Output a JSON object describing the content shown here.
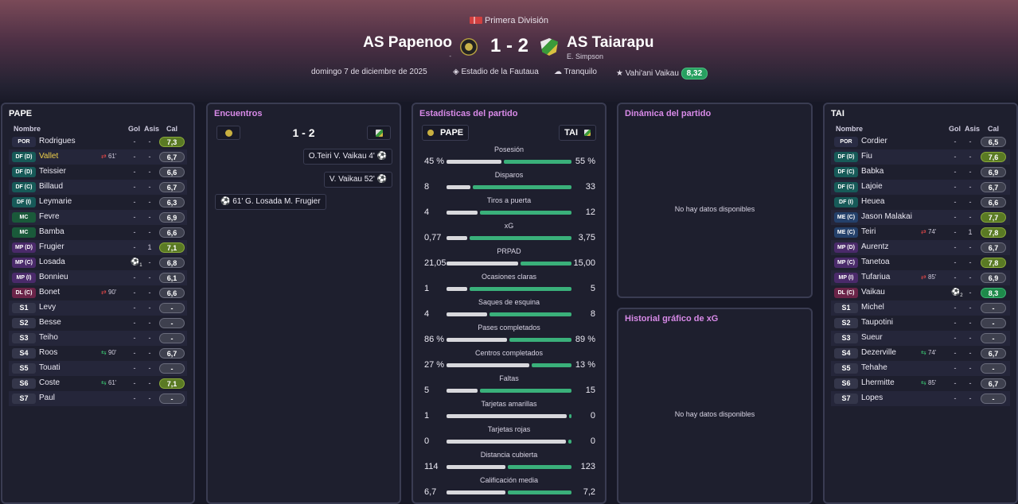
{
  "header": {
    "competition": "Primera División",
    "home_team": "AS Papenoo",
    "home_sub": "-",
    "away_team": "AS Taiarapu",
    "away_sub": "E. Simpson",
    "score": "1 - 2",
    "date": "domingo 7 de diciembre de 2025",
    "stadium": "Estadio de la Fautaua",
    "weather": "Tranquilo",
    "mvp": "Vahi'ani Vaikau",
    "mvp_rating": "8,32"
  },
  "home_lineup": {
    "title": "PAPE",
    "col_name": "Nombre",
    "col_gol": "Gol",
    "col_asis": "Asis",
    "col_cal": "Cal",
    "players": [
      {
        "pos": "POR",
        "cls": "por",
        "name": "Rodrigues",
        "sub": "",
        "gol": "-",
        "asis": "-",
        "cal": "7,3",
        "tier": "g1"
      },
      {
        "pos": "DF (D)",
        "cls": "df",
        "name": "Vallet",
        "sub": "61'",
        "subdir": "out",
        "gol": "-",
        "asis": "-",
        "cal": "6,7",
        "tier": "",
        "hl": true
      },
      {
        "pos": "DF (D)",
        "cls": "df",
        "name": "Teissier",
        "sub": "",
        "gol": "-",
        "asis": "-",
        "cal": "6,6",
        "tier": ""
      },
      {
        "pos": "DF (C)",
        "cls": "df",
        "name": "Billaud",
        "sub": "",
        "gol": "-",
        "asis": "-",
        "cal": "6,7",
        "tier": ""
      },
      {
        "pos": "DF (I)",
        "cls": "df",
        "name": "Leymarie",
        "sub": "",
        "gol": "-",
        "asis": "-",
        "cal": "6,3",
        "tier": ""
      },
      {
        "pos": "MC",
        "cls": "mc",
        "name": "Fevre",
        "sub": "",
        "gol": "-",
        "asis": "-",
        "cal": "6,9",
        "tier": ""
      },
      {
        "pos": "MC",
        "cls": "mc",
        "name": "Bamba",
        "sub": "",
        "gol": "-",
        "asis": "-",
        "cal": "6,6",
        "tier": ""
      },
      {
        "pos": "MP (D)",
        "cls": "mp",
        "name": "Frugier",
        "sub": "",
        "gol": "-",
        "asis": "1",
        "cal": "7,1",
        "tier": "g1"
      },
      {
        "pos": "MP (C)",
        "cls": "mp",
        "name": "Losada",
        "sub": "",
        "ball": "1",
        "gol": "",
        "asis": "-",
        "cal": "6,8",
        "tier": ""
      },
      {
        "pos": "MP (I)",
        "cls": "mp",
        "name": "Bonnieu",
        "sub": "",
        "gol": "-",
        "asis": "-",
        "cal": "6,1",
        "tier": ""
      },
      {
        "pos": "DL (C)",
        "cls": "dl",
        "name": "Bonet",
        "sub": "90'",
        "subdir": "out",
        "gol": "-",
        "asis": "-",
        "cal": "6,6",
        "tier": ""
      },
      {
        "pos": "S1",
        "cls": "sub",
        "name": "Levy",
        "sub": "",
        "gol": "-",
        "asis": "-",
        "cal": "-",
        "tier": ""
      },
      {
        "pos": "S2",
        "cls": "sub",
        "name": "Besse",
        "sub": "",
        "gol": "-",
        "asis": "-",
        "cal": "-",
        "tier": ""
      },
      {
        "pos": "S3",
        "cls": "sub",
        "name": "Teiho",
        "sub": "",
        "gol": "-",
        "asis": "-",
        "cal": "-",
        "tier": ""
      },
      {
        "pos": "S4",
        "cls": "sub",
        "name": "Roos",
        "sub": "90'",
        "subdir": "in",
        "gol": "-",
        "asis": "-",
        "cal": "6,7",
        "tier": ""
      },
      {
        "pos": "S5",
        "cls": "sub",
        "name": "Touati",
        "sub": "",
        "gol": "-",
        "asis": "-",
        "cal": "-",
        "tier": ""
      },
      {
        "pos": "S6",
        "cls": "sub",
        "name": "Coste",
        "sub": "61'",
        "subdir": "in",
        "gol": "-",
        "asis": "-",
        "cal": "7,1",
        "tier": "g1"
      },
      {
        "pos": "S7",
        "cls": "sub",
        "name": "Paul",
        "sub": "",
        "gol": "-",
        "asis": "-",
        "cal": "-",
        "tier": ""
      }
    ]
  },
  "away_lineup": {
    "title": "TAI",
    "col_name": "Nombre",
    "col_gol": "Gol",
    "col_asis": "Asis",
    "col_cal": "Cal",
    "players": [
      {
        "pos": "POR",
        "cls": "por",
        "name": "Cordier",
        "sub": "",
        "gol": "-",
        "asis": "-",
        "cal": "6,5",
        "tier": ""
      },
      {
        "pos": "DF (D)",
        "cls": "df",
        "name": "Fiu",
        "sub": "",
        "gol": "-",
        "asis": "-",
        "cal": "7,6",
        "tier": "g1"
      },
      {
        "pos": "DF (C)",
        "cls": "df",
        "name": "Babka",
        "sub": "",
        "gol": "-",
        "asis": "-",
        "cal": "6,9",
        "tier": ""
      },
      {
        "pos": "DF (C)",
        "cls": "df",
        "name": "Lajoie",
        "sub": "",
        "gol": "-",
        "asis": "-",
        "cal": "6,7",
        "tier": ""
      },
      {
        "pos": "DF (I)",
        "cls": "df",
        "name": "Heuea",
        "sub": "",
        "gol": "-",
        "asis": "-",
        "cal": "6,6",
        "tier": ""
      },
      {
        "pos": "ME (C)",
        "cls": "me",
        "name": "Jason Malakai",
        "sub": "",
        "gol": "-",
        "asis": "-",
        "cal": "7,7",
        "tier": "g1"
      },
      {
        "pos": "ME (C)",
        "cls": "me",
        "name": "Teiri",
        "sub": "74'",
        "subdir": "out",
        "gol": "-",
        "asis": "1",
        "cal": "7,8",
        "tier": "g1"
      },
      {
        "pos": "MP (D)",
        "cls": "mp",
        "name": "Aurentz",
        "sub": "",
        "gol": "-",
        "asis": "-",
        "cal": "6,7",
        "tier": ""
      },
      {
        "pos": "MP (C)",
        "cls": "mp",
        "name": "Tanetoa",
        "sub": "",
        "gol": "-",
        "asis": "-",
        "cal": "7,8",
        "tier": "g1"
      },
      {
        "pos": "MP (I)",
        "cls": "mp",
        "name": "Tufariua",
        "sub": "85'",
        "subdir": "out",
        "gol": "-",
        "asis": "-",
        "cal": "6,9",
        "tier": ""
      },
      {
        "pos": "DL (C)",
        "cls": "dl",
        "name": "Vaikau",
        "sub": "",
        "ball": "2",
        "gol": "",
        "asis": "-",
        "cal": "8,3",
        "tier": "g2"
      },
      {
        "pos": "S1",
        "cls": "sub",
        "name": "Michel",
        "sub": "",
        "gol": "-",
        "asis": "-",
        "cal": "-",
        "tier": ""
      },
      {
        "pos": "S2",
        "cls": "sub",
        "name": "Taupotini",
        "sub": "",
        "gol": "-",
        "asis": "-",
        "cal": "-",
        "tier": ""
      },
      {
        "pos": "S3",
        "cls": "sub",
        "name": "Sueur",
        "sub": "",
        "gol": "-",
        "asis": "-",
        "cal": "-",
        "tier": ""
      },
      {
        "pos": "S4",
        "cls": "sub",
        "name": "Dezerville",
        "sub": "74'",
        "subdir": "in",
        "gol": "-",
        "asis": "-",
        "cal": "6,7",
        "tier": ""
      },
      {
        "pos": "S5",
        "cls": "sub",
        "name": "Tehahe",
        "sub": "",
        "gol": "-",
        "asis": "-",
        "cal": "-",
        "tier": ""
      },
      {
        "pos": "S6",
        "cls": "sub",
        "name": "Lhermitte",
        "sub": "85'",
        "subdir": "in",
        "gol": "-",
        "asis": "-",
        "cal": "6,7",
        "tier": ""
      },
      {
        "pos": "S7",
        "cls": "sub",
        "name": "Lopes",
        "sub": "",
        "gol": "-",
        "asis": "-",
        "cal": "-",
        "tier": ""
      }
    ]
  },
  "encounters": {
    "title": "Encuentros",
    "score": "1 - 2",
    "events": [
      {
        "text": "O.Teiri  V. Vaikau  4'",
        "side": "away"
      },
      {
        "text": "V. Vaikau  52'",
        "side": "away"
      },
      {
        "text": "61'  G. Losada  M. Frugier",
        "side": "home"
      }
    ]
  },
  "stats": {
    "title": "Estadísticas del partido",
    "home_tag": "PAPE",
    "away_tag": "TAI",
    "rows": [
      {
        "label": "Posesión",
        "home": "45 %",
        "away": "55 %",
        "hv": 45,
        "av": 55
      },
      {
        "label": "Disparos",
        "home": "8",
        "away": "33",
        "hv": 8,
        "av": 33
      },
      {
        "label": "Tiros a puerta",
        "home": "4",
        "away": "12",
        "hv": 4,
        "av": 12
      },
      {
        "label": "xG",
        "home": "0,77",
        "away": "3,75",
        "hv": 0.77,
        "av": 3.75
      },
      {
        "label": "PRPAD",
        "home": "21,05",
        "away": "15,00",
        "hv": 21.05,
        "av": 15.0
      },
      {
        "label": "Ocasiones claras",
        "home": "1",
        "away": "5",
        "hv": 1,
        "av": 5
      },
      {
        "label": "Saques de esquina",
        "home": "4",
        "away": "8",
        "hv": 4,
        "av": 8
      },
      {
        "label": "Pases completados",
        "home": "86 %",
        "away": "89 %",
        "hv": 86,
        "av": 89
      },
      {
        "label": "Centros completados",
        "home": "27 %",
        "away": "13 %",
        "hv": 27,
        "av": 13
      },
      {
        "label": "Faltas",
        "home": "5",
        "away": "15",
        "hv": 5,
        "av": 15
      },
      {
        "label": "Tarjetas amarillas",
        "home": "1",
        "away": "0",
        "hv": 1,
        "av": 0
      },
      {
        "label": "Tarjetas rojas",
        "home": "0",
        "away": "0",
        "hv": 0,
        "av": 0
      },
      {
        "label": "Distancia cubierta",
        "home": "114",
        "away": "123",
        "hv": 114,
        "av": 123
      },
      {
        "label": "Calificación media",
        "home": "6,7",
        "away": "7,2",
        "hv": 6.7,
        "av": 7.2
      }
    ]
  },
  "dynamics": {
    "title": "Dinámica del partido",
    "empty": "No hay datos disponibles"
  },
  "xg_history": {
    "title": "Historial gráfico de xG",
    "empty": "No hay datos disponibles"
  },
  "colors": {
    "accent_title": "#d88ae8",
    "home_bar": "#d8d8dc",
    "away_bar": "#3ab07a",
    "rating_good": "#27a060"
  }
}
